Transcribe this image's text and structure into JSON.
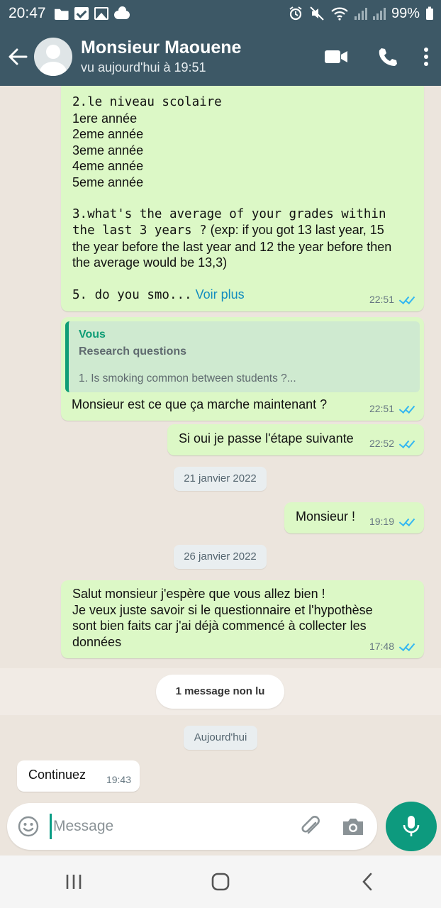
{
  "status_bar": {
    "time": "20:47",
    "battery": "99%",
    "icons": [
      "folder-icon",
      "check-icon",
      "image-icon",
      "cloud-icon",
      "alarm-icon",
      "mute-icon",
      "wifi-icon",
      "signal-icon"
    ]
  },
  "header": {
    "contact_name": "Monsieur Maouene",
    "last_seen": "vu aujourd'hui à 19:51",
    "icons": [
      "back-arrow-icon",
      "avatar",
      "video-call-icon",
      "phone-icon",
      "more-vert-icon"
    ]
  },
  "messages": [
    {
      "direction": "out",
      "lines": [
        {
          "text": "2.le niveau scolaire",
          "mono": true
        },
        {
          "text": "1ere année",
          "mono": false
        },
        {
          "text": "2eme année",
          "mono": false
        },
        {
          "text": "3eme année",
          "mono": false
        },
        {
          "text": "4eme année",
          "mono": false
        },
        {
          "text": "5eme année",
          "mono": false
        },
        {
          "text": "",
          "mono": false
        },
        {
          "text": "3.what's the average of your grades within",
          "mono": true
        },
        {
          "text_mono": "the last 3 years ?",
          "text": " (exp: if you got 13 last year, 15"
        },
        {
          "text": "the year before the last year and 12 the year before then",
          "mono": false
        },
        {
          "text": "the average would be 13,3)",
          "mono": false
        },
        {
          "text": "",
          "mono": false
        },
        {
          "text": "5. do you smo...",
          "mono": true
        }
      ],
      "see_more": "Voir plus",
      "time": "22:51"
    },
    {
      "direction": "out",
      "quote_author": "Vous",
      "quote_title": "Research questions",
      "quote_snippet": "1. Is smoking common between students ?...",
      "text": "Monsieur est ce que ça marche maintenant ?",
      "time": "22:51"
    },
    {
      "direction": "out",
      "text": "Si oui je passe l'étape suivante",
      "time": "22:52"
    },
    {
      "direction": "out",
      "text": "Monsieur !",
      "time": "19:19"
    },
    {
      "direction": "out",
      "lines": [
        "Salut monsieur j'espère que vous allez bien !",
        "Je veux juste savoir si le questionnaire et l'hypothèse",
        "sont bien faits car j'ai déjà commencé à collecter les",
        "données"
      ],
      "time": "17:48"
    },
    {
      "direction": "in",
      "text": "Continuez",
      "time": "19:43"
    }
  ],
  "date_separators": [
    "21 janvier 2022",
    "26 janvier 2022",
    "Aujourd'hui"
  ],
  "unread_label": "1 message non lu",
  "input": {
    "placeholder": "Message",
    "icons": [
      "emoji-icon",
      "attach-icon",
      "camera-icon",
      "mic-icon"
    ]
  },
  "nav": {
    "icons": [
      "recent-apps-icon",
      "home-icon",
      "back-icon"
    ]
  },
  "colors": {
    "header_bg": "#3d5866",
    "outgoing_bubble": "#dcf8c6",
    "incoming_bubble": "#ffffff",
    "read_ticks": "#34b7f1",
    "accent": "#0d9a7e",
    "chat_bg": "#ece5dd"
  }
}
